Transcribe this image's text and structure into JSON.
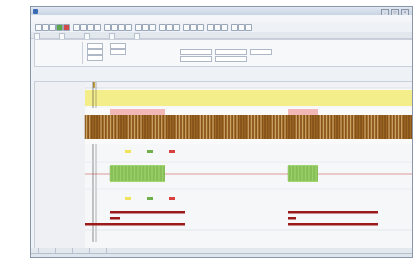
{
  "window": {
    "title": "",
    "buttons": [
      "_",
      "□",
      "×"
    ]
  },
  "menu": [
    "",
    "",
    "",
    "",
    "",
    ""
  ],
  "tabs": [
    "",
    "",
    "",
    "",
    ""
  ],
  "bottom_tabs": [
    "",
    "",
    "",
    "",
    ""
  ],
  "channels": {
    "top_marker": "",
    "channel1": "",
    "channel2": "",
    "digital": [
      "",
      "",
      ""
    ]
  },
  "legend1": [
    "",
    "",
    ""
  ],
  "legend2": [
    "",
    "",
    ""
  ],
  "colors": {
    "yellow_band": "#f3ee8a",
    "trace_brown": "#8a5a1a",
    "pink_band": "#f2b8b8",
    "green_band": "#9fd66e",
    "green_trace": "#5d8f2f",
    "red_trace": "#b23232",
    "dark_red": "#9b1b1b",
    "legend_yellow": "#f0e35a",
    "legend_green": "#6fb04a",
    "legend_red": "#d94040"
  },
  "icons": [
    "app-icon",
    "toolbar-icon",
    "run-icon",
    "stop-icon"
  ]
}
